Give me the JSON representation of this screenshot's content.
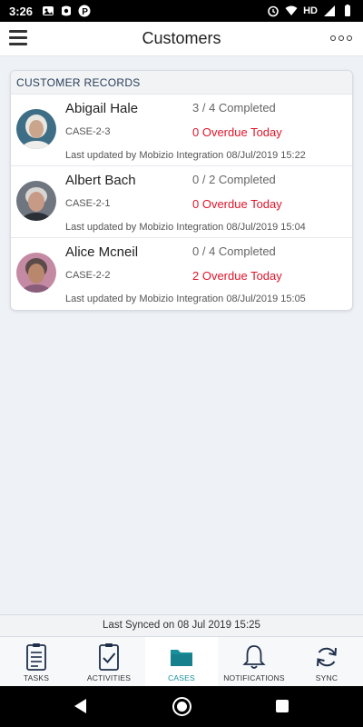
{
  "status_bar": {
    "time": "3:26",
    "network": "HD"
  },
  "app_bar": {
    "title": "Customers"
  },
  "card": {
    "header": "CUSTOMER RECORDS",
    "records": [
      {
        "name": "Abigail Hale",
        "case_id": "CASE-2-3",
        "progress": "3 / 4 Completed",
        "overdue": "0 Overdue Today",
        "updated": "Last updated by Mobizio Integration 08/Jul/2019 15:22"
      },
      {
        "name": "Albert Bach",
        "case_id": "CASE-2-1",
        "progress": "0 / 2 Completed",
        "overdue": "0 Overdue Today",
        "updated": "Last updated by Mobizio Integration 08/Jul/2019 15:04"
      },
      {
        "name": "Alice Mcneil",
        "case_id": "CASE-2-2",
        "progress": "0 / 4 Completed",
        "overdue": "2 Overdue Today",
        "updated": "Last updated by Mobizio Integration 08/Jul/2019 15:05"
      }
    ]
  },
  "sync_bar": {
    "text": "Last Synced on 08 Jul 2019 15:25"
  },
  "tabs": [
    {
      "label": "TASKS",
      "icon": "clipboard-list-icon"
    },
    {
      "label": "ACTIVITIES",
      "icon": "clipboard-check-icon"
    },
    {
      "label": "CASES",
      "icon": "folder-icon",
      "active": true
    },
    {
      "label": "NOTIFICATIONS",
      "icon": "bell-icon"
    },
    {
      "label": "SYNC",
      "icon": "sync-icon"
    }
  ],
  "colors": {
    "accent": "#1a8f9c",
    "overdue": "#e0162b",
    "header_text": "#2a3f5a"
  }
}
